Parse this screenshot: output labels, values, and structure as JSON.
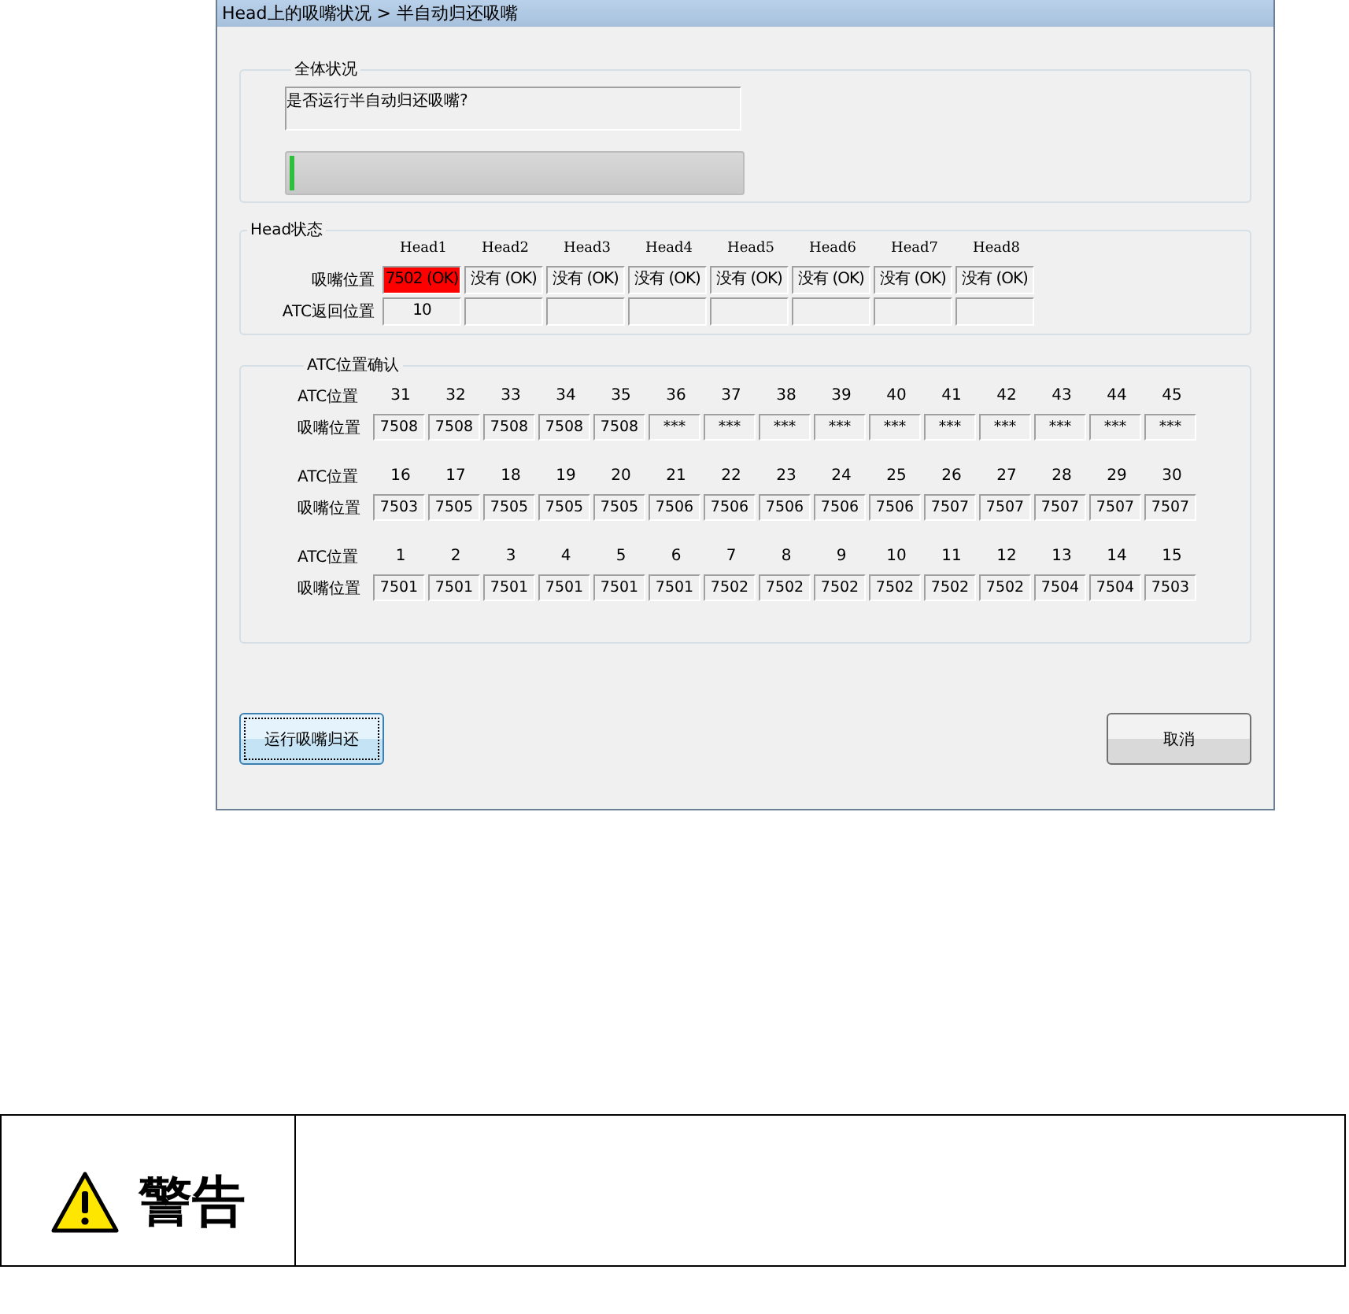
{
  "window": {
    "title": "Head上的吸嘴状况 > 半自动归还吸嘴"
  },
  "overall": {
    "title": "全体状况",
    "message": "是否运行半自动归还吸嘴?",
    "level": 0.01
  },
  "head_status": {
    "title": "Head状态",
    "row_labels": [
      "吸嘴位置",
      "ATC返回位置"
    ],
    "heads": [
      {
        "name": "Head1",
        "nozzle": "7502 (OK)",
        "return": "10",
        "alert": true
      },
      {
        "name": "Head2",
        "nozzle": "没有 (OK)",
        "alert": false
      },
      {
        "name": "Head3",
        "nozzle": "没有 (OK)",
        "alert": false
      },
      {
        "name": "Head4",
        "nozzle": "没有 (OK)",
        "alert": false
      },
      {
        "name": "Head5",
        "nozzle": "没有 (OK)",
        "alert": false
      },
      {
        "name": "Head6",
        "nozzle": "没有 (OK)",
        "alert": false
      },
      {
        "name": "Head7",
        "nozzle": "没有 (OK)",
        "alert": false
      },
      {
        "name": "Head8",
        "nozzle": "没有 (OK)",
        "alert": false
      }
    ]
  },
  "atc": {
    "title": "ATC位置确认",
    "groups": [
      {
        "atc_label": "ATC位置",
        "nozzle_label": "吸嘴位置",
        "positions": [
          {
            "atc": "31",
            "nozzle": "7508"
          },
          {
            "atc": "32",
            "nozzle": "7508"
          },
          {
            "atc": "33",
            "nozzle": "7508"
          },
          {
            "atc": "34",
            "nozzle": "7508"
          },
          {
            "atc": "35",
            "nozzle": "7508"
          },
          {
            "atc": "36",
            "nozzle": "***"
          },
          {
            "atc": "37",
            "nozzle": "***"
          },
          {
            "atc": "38",
            "nozzle": "***"
          },
          {
            "atc": "39",
            "nozzle": "***"
          },
          {
            "atc": "40",
            "nozzle": "***"
          },
          {
            "atc": "41",
            "nozzle": "***"
          },
          {
            "atc": "42",
            "nozzle": "***"
          },
          {
            "atc": "43",
            "nozzle": "***"
          },
          {
            "atc": "44",
            "nozzle": "***"
          },
          {
            "atc": "45",
            "nozzle": "***"
          }
        ]
      },
      {
        "atc_label": "ATC位置",
        "nozzle_label": "吸嘴位置",
        "positions": [
          {
            "atc": "16",
            "nozzle": "7503"
          },
          {
            "atc": "17",
            "nozzle": "7505"
          },
          {
            "atc": "18",
            "nozzle": "7505"
          },
          {
            "atc": "19",
            "nozzle": "7505"
          },
          {
            "atc": "20",
            "nozzle": "7505"
          },
          {
            "atc": "21",
            "nozzle": "7506"
          },
          {
            "atc": "22",
            "nozzle": "7506"
          },
          {
            "atc": "23",
            "nozzle": "7506"
          },
          {
            "atc": "24",
            "nozzle": "7506"
          },
          {
            "atc": "25",
            "nozzle": "7506"
          },
          {
            "atc": "26",
            "nozzle": "7507"
          },
          {
            "atc": "27",
            "nozzle": "7507"
          },
          {
            "atc": "28",
            "nozzle": "7507"
          },
          {
            "atc": "29",
            "nozzle": "7507"
          },
          {
            "atc": "30",
            "nozzle": "7507"
          }
        ]
      },
      {
        "atc_label": "ATC位置",
        "nozzle_label": "吸嘴位置",
        "positions": [
          {
            "atc": "1",
            "nozzle": "7501"
          },
          {
            "atc": "2",
            "nozzle": "7501"
          },
          {
            "atc": "3",
            "nozzle": "7501"
          },
          {
            "atc": "4",
            "nozzle": "7501"
          },
          {
            "atc": "5",
            "nozzle": "7501"
          },
          {
            "atc": "6",
            "nozzle": "7501"
          },
          {
            "atc": "7",
            "nozzle": "7502"
          },
          {
            "atc": "8",
            "nozzle": "7502"
          },
          {
            "atc": "9",
            "nozzle": "7502"
          },
          {
            "atc": "10",
            "nozzle": "7502"
          },
          {
            "atc": "11",
            "nozzle": "7502"
          },
          {
            "atc": "12",
            "nozzle": "7502"
          },
          {
            "atc": "13",
            "nozzle": "7504"
          },
          {
            "atc": "14",
            "nozzle": "7504"
          },
          {
            "atc": "15",
            "nozzle": "7503"
          }
        ]
      }
    ]
  },
  "buttons": [
    {
      "label": "运行吸嘴归还",
      "default": true
    },
    {
      "label": "取消",
      "default": false
    }
  ],
  "warning": {
    "label": "警告"
  }
}
